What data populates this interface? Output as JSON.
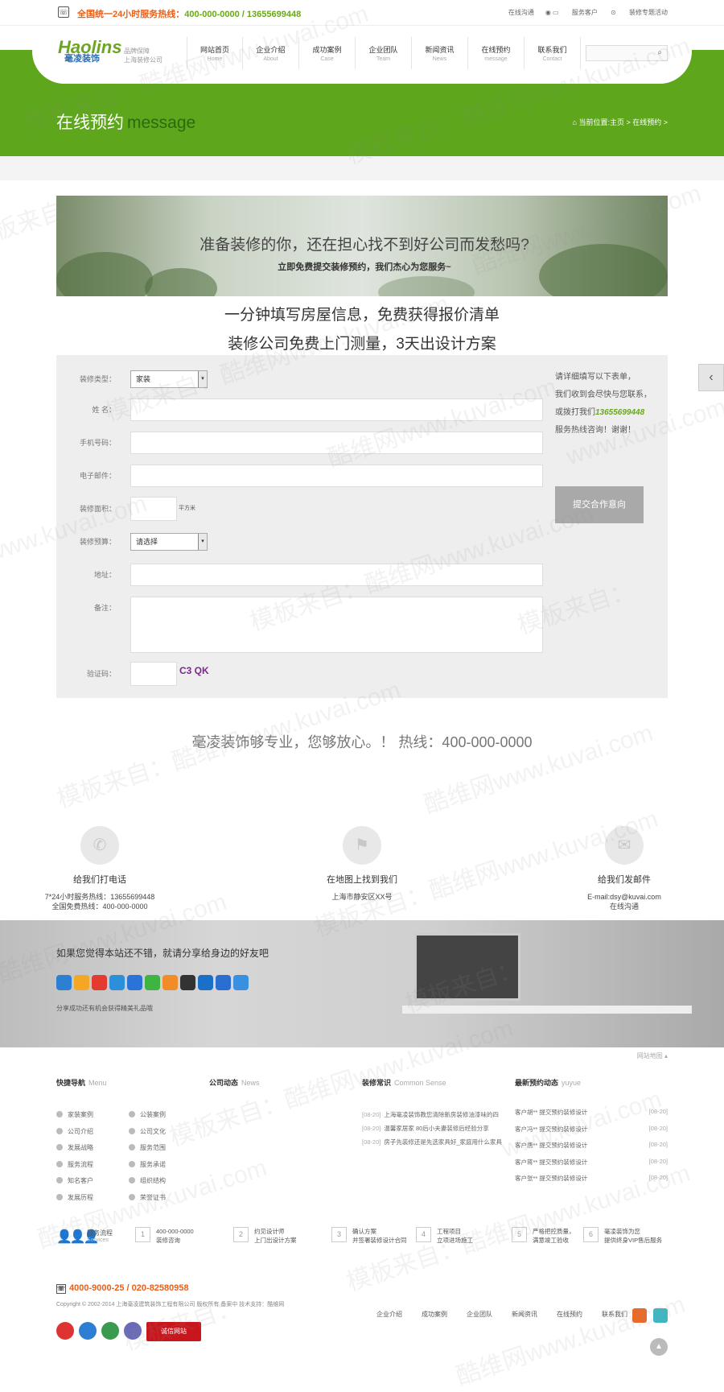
{
  "topbar": {
    "hotline_label": "全国统一24小时服务热线：",
    "hotline_numbers": "400-000-0000 / 13655699448",
    "online_chat": "在线沟通",
    "service_clients": "服务客户",
    "decor_topics": "装修专题活动"
  },
  "logo": {
    "text": "Haolins",
    "cn": "毫凌装饰",
    "sub1": "品牌保障",
    "sub2": "上海装修公司"
  },
  "nav": [
    {
      "cn": "网站首页",
      "en": "Home"
    },
    {
      "cn": "企业介绍",
      "en": "About"
    },
    {
      "cn": "成功案例",
      "en": "Case"
    },
    {
      "cn": "企业团队",
      "en": "Team"
    },
    {
      "cn": "新闻资讯",
      "en": "News"
    },
    {
      "cn": "在线预约",
      "en": "message"
    },
    {
      "cn": "联系我们",
      "en": "Contact"
    }
  ],
  "page": {
    "title": "在线预约",
    "title_en": "message",
    "breadcrumb": "当前位置:主页 > 在线预约 >"
  },
  "banner": {
    "line1": "准备装修的你，还在担心找不到好公司而发愁吗?",
    "line2": "立即免费提交装修预约，我们杰心为您服务~"
  },
  "headline1": "一分钟填写房屋信息，免费获得报价清单",
  "headline2": "装修公司免费上门测量，3天出设计方案",
  "form": {
    "type_label": "装修类型：",
    "type_value": "家装",
    "name_label": "姓    名：",
    "phone_label": "手机号码：",
    "email_label": "电子邮件：",
    "area_label": "装修面积：",
    "area_unit": "平方米",
    "budget_label": "装修预算：",
    "budget_value": "请选择",
    "address_label": "地址：",
    "remark_label": "备注：",
    "captcha_label": "验证码：",
    "captcha_text": "C3 QK",
    "side_note1": "请详细填写以下表单，",
    "side_note2": "我们收到会尽快与您联系，",
    "side_note3": "或拨打我们",
    "side_tel": "13655699448",
    "side_note4": "服务热线咨询！谢谢！",
    "submit_label": "提交合作意向"
  },
  "assurance": "毫凌装饰够专业，您够放心。！ 热线：400-000-0000",
  "contact": [
    {
      "title": "给我们打电话",
      "line1": "7*24小时服务热线：13655699448",
      "line2": "全国免费热线：400-000-0000"
    },
    {
      "title": "在地图上找到我们",
      "line1": "上海市静安区XX号",
      "line2": ""
    },
    {
      "title": "给我们发邮件",
      "line1": "E-mail:dsy@kuvai.com",
      "line2": "在线沟通"
    }
  ],
  "share": {
    "question": "如果您觉得本站还不错，就请分享给身边的好友吧",
    "note": "分享成功还有机会获得精美礼品哦"
  },
  "sitemap": "网站地图",
  "footer": {
    "quick_nav": {
      "title": "快捷导航",
      "en": "Menu",
      "left": [
        "家装案例",
        "公司介绍",
        "发展战略",
        "服务流程",
        "知名客户",
        "发展历程"
      ],
      "right": [
        "公装案例",
        "公司文化",
        "服务范围",
        "服务承诺",
        "组织结构",
        "荣誉证书"
      ]
    },
    "company_news": {
      "title": "公司动态",
      "en": "News"
    },
    "common_sense": {
      "title": "装修常识",
      "en": "Common Sense",
      "items": [
        {
          "date": "[08-20]",
          "text": "上海毫凌装饰教您清除新房装修油漆味的四"
        },
        {
          "date": "[08-20]",
          "text": "温馨家居家 80后小夫妻装修后经验分享"
        },
        {
          "date": "[08-20]",
          "text": "房子先装修还是先选家具好_家庭用什么家具"
        }
      ]
    },
    "bookings": {
      "title": "最新预约动态",
      "en": "yuyue",
      "items": [
        {
          "text": "客户胡** 提交预约装修设计",
          "date": "[08-20]"
        },
        {
          "text": "客户冯** 提交预约装修设计",
          "date": "[08-20]"
        },
        {
          "text": "客户唐** 提交预约装修设计",
          "date": "[08-20]"
        },
        {
          "text": "客户蒋** 提交预约装修设计",
          "date": "[08-20]"
        },
        {
          "text": "客户张** 提交预约装修设计",
          "date": "[08-20]"
        }
      ]
    }
  },
  "flow": {
    "title": "服务流程",
    "en": "Services",
    "steps": [
      {
        "n": "1",
        "a": "400-000-0000",
        "b": "装修咨询"
      },
      {
        "n": "2",
        "a": "约见设计师",
        "b": "上门出设计方案"
      },
      {
        "n": "3",
        "a": "确认方案",
        "b": "并签署装修设计合同"
      },
      {
        "n": "4",
        "a": "工程项目",
        "b": "立项进场施工"
      },
      {
        "n": "5",
        "a": "严格把控质量，",
        "b": "满意竣工验收"
      },
      {
        "n": "6",
        "a": "毫凌装饰为您",
        "b": "提供终身VIP售后服务"
      }
    ]
  },
  "bottom": {
    "phones": "4000-9000-25 / 020-82580958",
    "copyright": "Copyright © 2002-2014 上海毫凌建筑装饰工程有限公司 版权所有 备案中 技术支持：酷维网",
    "links": [
      "企业介绍",
      "成功案例",
      "企业团队",
      "新闻资讯",
      "在线预约",
      "联系我们"
    ],
    "badge_text": "诚信网站"
  },
  "watermark": [
    "模板来自：酷维网www.kuvai.com",
    "酷维网www.kuvai.com",
    "模板来自：",
    "www.kuvai.com"
  ],
  "colors": {
    "brand_green": "#5ea61c",
    "accent_orange": "#e85f1a",
    "weibo": "#e86b2c",
    "teal": "#3fb7c3"
  }
}
